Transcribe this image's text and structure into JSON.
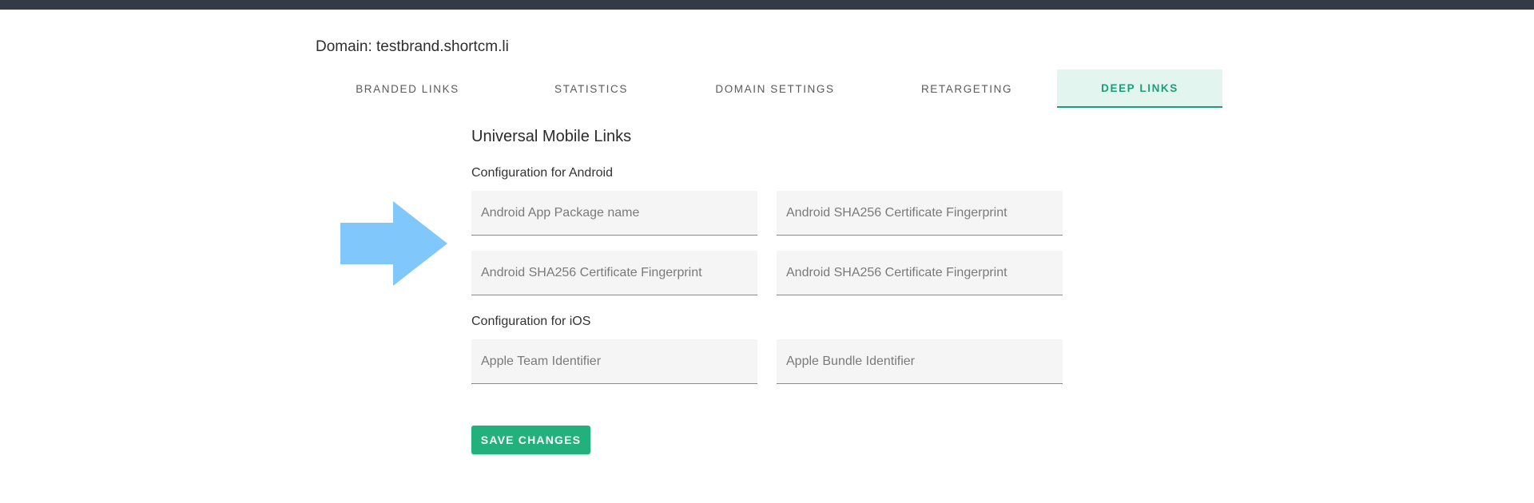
{
  "header": {
    "domain_title": "Domain: testbrand.shortcm.li"
  },
  "tabs": [
    {
      "label": "BRANDED LINKS",
      "active": false
    },
    {
      "label": "STATISTICS",
      "active": false
    },
    {
      "label": "DOMAIN SETTINGS",
      "active": false
    },
    {
      "label": "RETARGETING",
      "active": false
    },
    {
      "label": "DEEP LINKS",
      "active": true
    }
  ],
  "main": {
    "section_title": "Universal Mobile Links",
    "android": {
      "label": "Configuration for Android",
      "fields": [
        {
          "placeholder": "Android App Package name",
          "value": ""
        },
        {
          "placeholder": "Android SHA256 Certificate Fingerprint",
          "value": ""
        },
        {
          "placeholder": "Android SHA256 Certificate Fingerprint",
          "value": ""
        },
        {
          "placeholder": "Android SHA256 Certificate Fingerprint",
          "value": ""
        }
      ]
    },
    "ios": {
      "label": "Configuration for iOS",
      "fields": [
        {
          "placeholder": "Apple Team Identifier",
          "value": ""
        },
        {
          "placeholder": "Apple Bundle Identifier",
          "value": ""
        }
      ]
    },
    "save_label": "SAVE CHANGES"
  },
  "annotation": {
    "arrow_icon": "right-arrow-icon",
    "arrow_color": "#80c8fc"
  },
  "colors": {
    "accent": "#22b07d",
    "active_tab_bg": "#e3f5ef",
    "topbar": "#343a46"
  }
}
